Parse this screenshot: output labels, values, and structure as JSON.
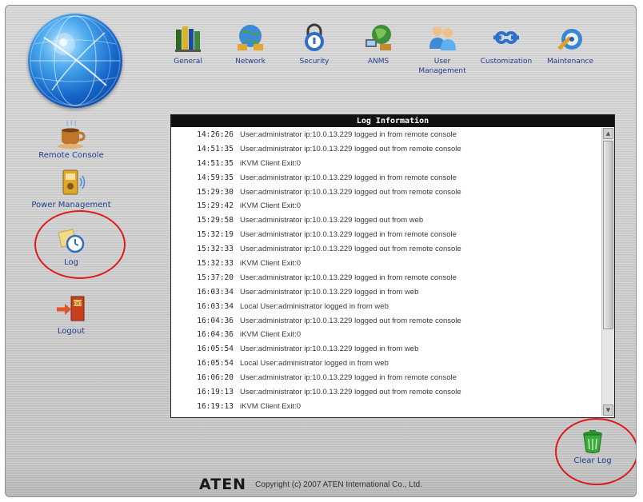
{
  "colors": {
    "link": "#1f3f8f",
    "header_bg": "#111111",
    "annotation": "#e01a1a",
    "frame_bg": "#c9c9c9"
  },
  "top_nav": [
    {
      "label": "General",
      "icon": "books-icon"
    },
    {
      "label": "Network",
      "icon": "network-globe-icon"
    },
    {
      "label": "Security",
      "icon": "padlock-icon"
    },
    {
      "label": "ANMS",
      "icon": "network-devices-icon"
    },
    {
      "label": "User Management",
      "icon": "users-icon"
    },
    {
      "label": "Customization",
      "icon": "wrench-icon"
    },
    {
      "label": "Maintenance",
      "icon": "maintenance-icon"
    }
  ],
  "sidebar": [
    {
      "label": "Remote Console",
      "icon": "coffee-cup-icon"
    },
    {
      "label": "Power Management",
      "icon": "power-icon"
    },
    {
      "label": "Log",
      "icon": "clock-note-icon"
    },
    {
      "label": "Logout",
      "icon": "exit-door-icon"
    }
  ],
  "log": {
    "title": "Log Information",
    "entries": [
      {
        "time": "14:26:26",
        "message": "User:administrator ip:10.0.13.229 logged in from remote console"
      },
      {
        "time": "14:51:35",
        "message": "User:administrator ip:10.0.13.229 logged out from remote console"
      },
      {
        "time": "14:51:35",
        "message": "iKVM Client Exit:0"
      },
      {
        "time": "14:59:35",
        "message": "User:administrator ip:10.0.13.229 logged in from remote console"
      },
      {
        "time": "15:29:30",
        "message": "User:administrator ip:10.0.13.229 logged out from remote console"
      },
      {
        "time": "15:29:42",
        "message": "iKVM Client Exit:0"
      },
      {
        "time": "15:29:58",
        "message": "User:administrator ip:10.0.13.229 logged out from web"
      },
      {
        "time": "15:32:19",
        "message": "User:administrator ip:10.0.13.229 logged in from remote console"
      },
      {
        "time": "15:32:33",
        "message": "User:administrator ip:10.0.13.229 logged out from remote console"
      },
      {
        "time": "15:32:33",
        "message": "iKVM Client Exit:0"
      },
      {
        "time": "15:37:20",
        "message": "User:administrator ip:10.0.13.229 logged in from remote console"
      },
      {
        "time": "16:03:34",
        "message": "User:administrator ip:10.0.13.229 logged in from web"
      },
      {
        "time": "16:03:34",
        "message": "Local User:administrator logged in from web"
      },
      {
        "time": "16:04:36",
        "message": "User:administrator ip:10.0.13.229 logged out from remote console"
      },
      {
        "time": "16:04:36",
        "message": "iKVM Client Exit:0"
      },
      {
        "time": "16:05:54",
        "message": "User:administrator ip:10.0.13.229 logged in from web"
      },
      {
        "time": "16:05:54",
        "message": "Local User:administrator logged in from web"
      },
      {
        "time": "16:06:20",
        "message": "User:administrator ip:10.0.13.229 logged in from remote console"
      },
      {
        "time": "16:19:13",
        "message": "User:administrator ip:10.0.13.229 logged out from remote console"
      },
      {
        "time": "16:19:13",
        "message": "iKVM Client Exit:0"
      }
    ]
  },
  "actions": {
    "clear_log": "Clear Log"
  },
  "footer": {
    "brand": "ATEN",
    "copyright": "Copyright (c) 2007 ATEN International Co., Ltd."
  }
}
